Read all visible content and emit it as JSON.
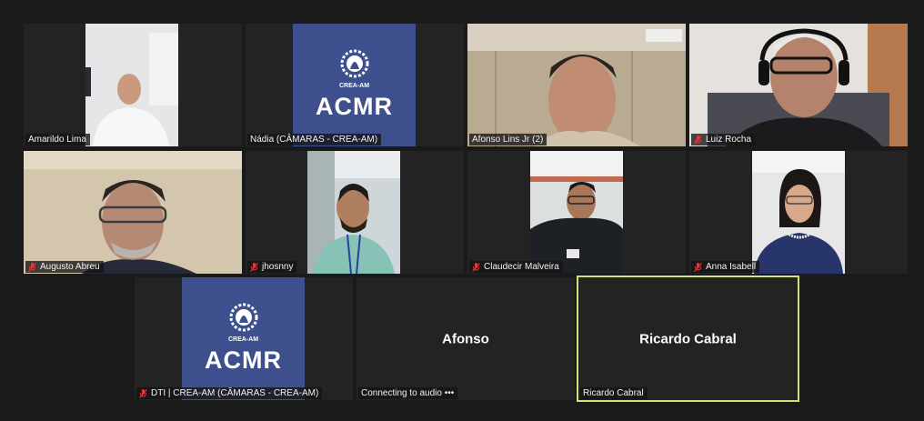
{
  "participants": [
    {
      "name": "Amarildo Lima",
      "muted": false,
      "type": "video"
    },
    {
      "name": "Nádia (CÂMARAS - CREA-AM)",
      "muted": false,
      "type": "logo"
    },
    {
      "name": "Afonso Lins Jr (2)",
      "muted": false,
      "type": "video"
    },
    {
      "name": "Luiz Rocha",
      "muted": true,
      "type": "video"
    },
    {
      "name": "Augusto Abreu",
      "muted": true,
      "type": "video"
    },
    {
      "name": "jhosnny",
      "muted": true,
      "type": "video"
    },
    {
      "name": "Claudecir Malveira",
      "muted": true,
      "type": "video"
    },
    {
      "name": "Anna Isabell",
      "muted": true,
      "type": "video"
    },
    {
      "name": "DTI | CREA-AM (CÂMARAS - CREA-AM)",
      "muted": true,
      "type": "logo"
    },
    {
      "name": "Afonso",
      "status": "Connecting to audio •••",
      "type": "text"
    },
    {
      "name": "Ricardo Cabral",
      "active": true,
      "type": "text"
    }
  ],
  "logo": {
    "text": "ACMR",
    "badge": "CREA-AM",
    "color": "#3d4f8d"
  },
  "colors": {
    "active_border": "#d5e07c",
    "muted_icon": "#e8373a",
    "background": "#1a1a1a"
  }
}
